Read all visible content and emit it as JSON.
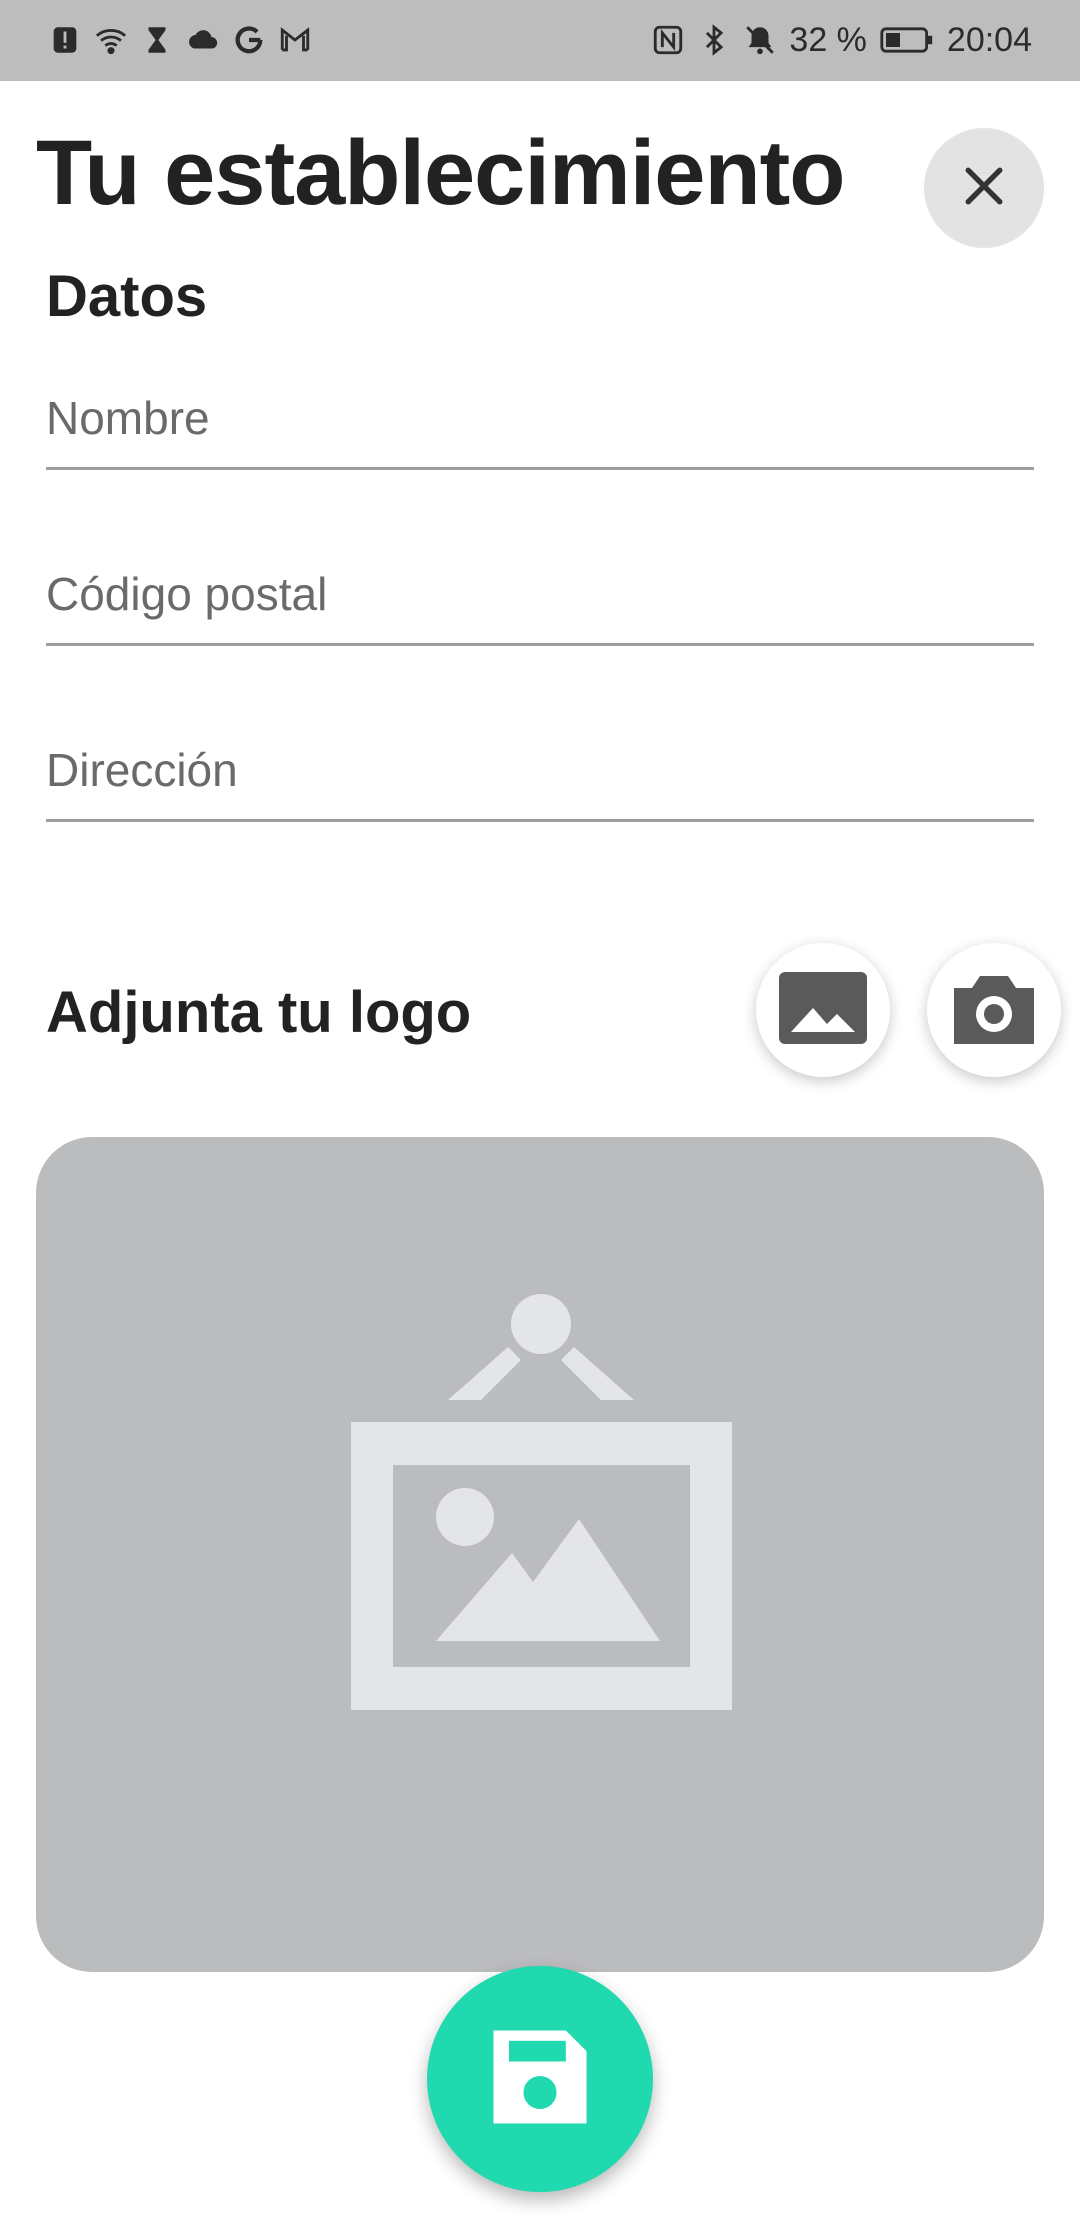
{
  "status_bar": {
    "battery_percent": "32 %",
    "time": "20:04",
    "left_icons": [
      "alert-icon",
      "wifi-icon",
      "hourglass-icon",
      "cloud-icon",
      "google-icon",
      "gmail-icon"
    ],
    "right_icons": [
      "nfc-icon",
      "bluetooth-icon",
      "bell-off-icon",
      "battery-icon"
    ]
  },
  "header": {
    "title": "Tu establecimiento",
    "close_icon": "close-icon"
  },
  "datos": {
    "section_title": "Datos",
    "fields": [
      {
        "placeholder": "Nombre",
        "value": ""
      },
      {
        "placeholder": "Código postal",
        "value": ""
      },
      {
        "placeholder": "Dirección",
        "value": ""
      }
    ]
  },
  "logo": {
    "section_title": "Adjunta tu logo",
    "gallery_icon": "image-gallery-icon",
    "camera_icon": "camera-icon",
    "placeholder_icon": "image-placeholder-icon"
  },
  "save": {
    "icon": "save-icon"
  },
  "colors": {
    "accent": "#21d9ae",
    "status_bar": "#bdbdbd",
    "placeholder_bg": "#bbbcbe",
    "icon_dark": "#5a5a5a"
  }
}
